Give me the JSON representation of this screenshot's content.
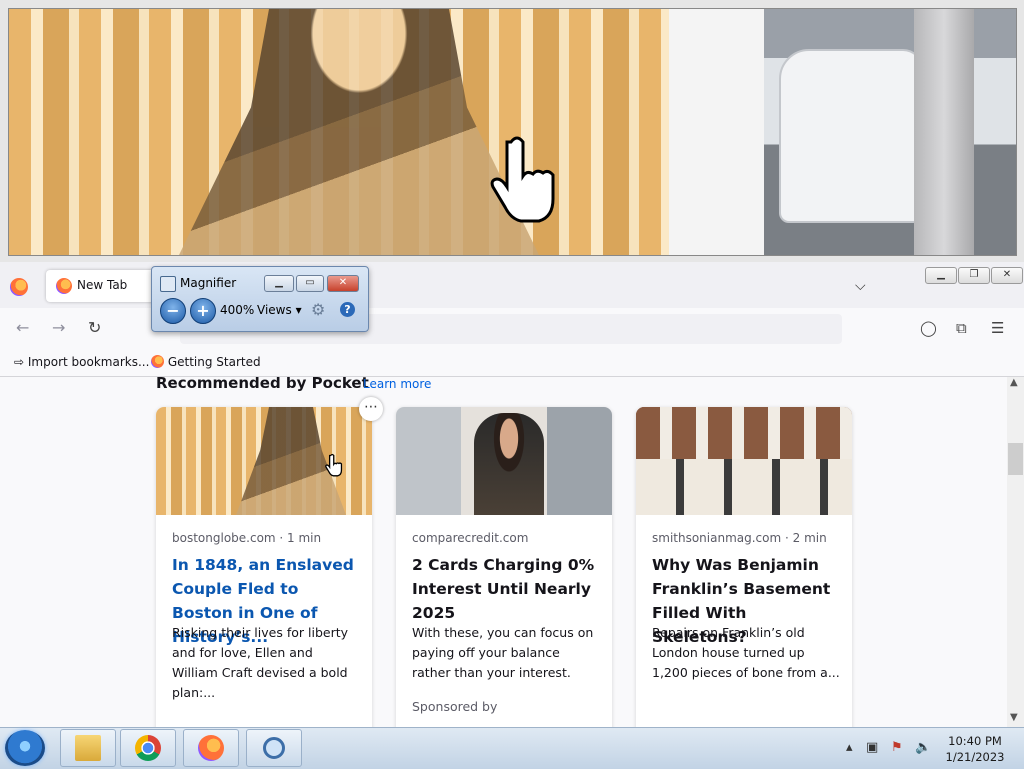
{
  "magnifier_window": {
    "title": "Magnifier",
    "zoom_level": "400%",
    "views_label": "Views",
    "minimize_glyph": "▁",
    "restore_glyph": "▭",
    "close_glyph": "✕",
    "zoom_out_glyph": "−",
    "zoom_in_glyph": "+",
    "help_glyph": "?"
  },
  "browser": {
    "tab_title": "New Tab",
    "tab_list_glyph": "⌵",
    "window_buttons": {
      "minimize": "▁",
      "restore": "❐",
      "close": "✕"
    },
    "urlbar_value": "",
    "bookmarks": [
      {
        "label": "Import bookmarks...",
        "icon": "import-icon"
      },
      {
        "label": "Getting Started",
        "icon": "firefox-icon"
      }
    ]
  },
  "pocket": {
    "heading": "Recommended by Pocket",
    "learn_more": "Learn more",
    "cards": [
      {
        "source": "bostonglobe.com · 1 min",
        "title": "In 1848, an Enslaved Couple Fled to Boston in One of History’s...",
        "excerpt": "Risking their lives for liberty and for love, Ellen and William Craft devised a bold plan:...",
        "sponsor": ""
      },
      {
        "source": "comparecredit.com",
        "title": "2 Cards Charging 0% Interest Until Nearly 2025",
        "excerpt": "With these, you can focus on paying off your balance rather than your interest.",
        "sponsor": "Sponsored by"
      },
      {
        "source": "smithsonianmag.com · 2 min",
        "title": "Why Was Benjamin Franklin’s Basement Filled With Skeletons?",
        "excerpt": "Repairs on Franklin’s old London house turned up 1,200 pieces of bone from a...",
        "sponsor": ""
      }
    ]
  },
  "taskbar": {
    "apps": [
      "windows-explorer",
      "chrome",
      "firefox",
      "magnifier"
    ],
    "clock_time": "10:40 PM",
    "clock_date": "1/21/2023"
  },
  "colors": {
    "link_blue": "#0b57b0",
    "learn_more_blue": "#0061e0",
    "taskbar": "#c2d3e5"
  }
}
